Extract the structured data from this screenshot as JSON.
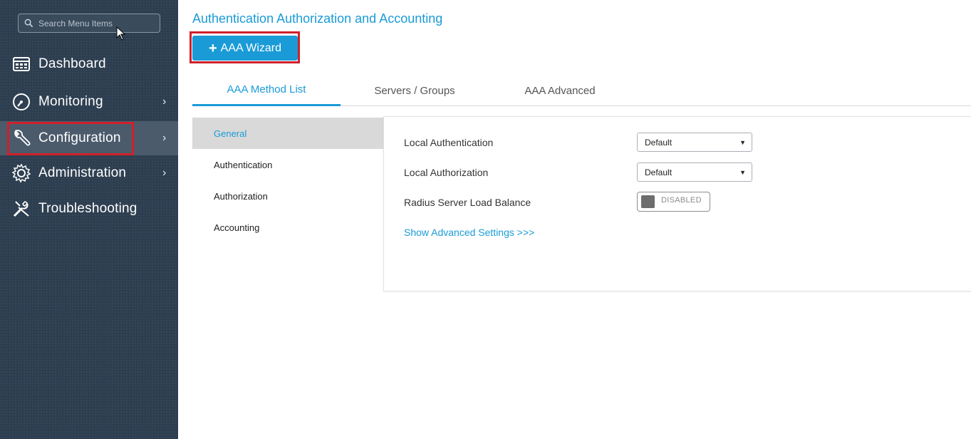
{
  "sidebar": {
    "search_placeholder": "Search Menu Items",
    "items": [
      {
        "label": "Dashboard",
        "icon": "dashboard-icon",
        "chevron": ""
      },
      {
        "label": "Monitoring",
        "icon": "gauge-icon",
        "chevron": "›"
      },
      {
        "label": "Configuration",
        "icon": "wrench-icon",
        "chevron": "›"
      },
      {
        "label": "Administration",
        "icon": "gear-icon",
        "chevron": "›"
      },
      {
        "label": "Troubleshooting",
        "icon": "tools-icon",
        "chevron": ""
      }
    ],
    "active": "Configuration"
  },
  "page": {
    "title": "Authentication Authorization and Accounting",
    "wizard_button": {
      "plus": "+",
      "label": "AAA Wizard"
    }
  },
  "tabs": [
    {
      "label": "AAA Method List",
      "active": true
    },
    {
      "label": "Servers / Groups",
      "active": false
    },
    {
      "label": "AAA Advanced",
      "active": false
    }
  ],
  "subnav": [
    {
      "label": "General",
      "active": true
    },
    {
      "label": "Authentication",
      "active": false
    },
    {
      "label": "Authorization",
      "active": false
    },
    {
      "label": "Accounting",
      "active": false
    }
  ],
  "form": {
    "local_authentication": {
      "label": "Local Authentication",
      "value": "Default"
    },
    "local_authorization": {
      "label": "Local Authorization",
      "value": "Default"
    },
    "radius_load_balance": {
      "label": "Radius Server Load Balance",
      "state": "DISABLED"
    },
    "advanced_link": "Show Advanced Settings >>>"
  },
  "colors": {
    "accent": "#1a9bd7",
    "sidebar_bg": "#2d3e50",
    "highlight_box": "#d0202a"
  }
}
